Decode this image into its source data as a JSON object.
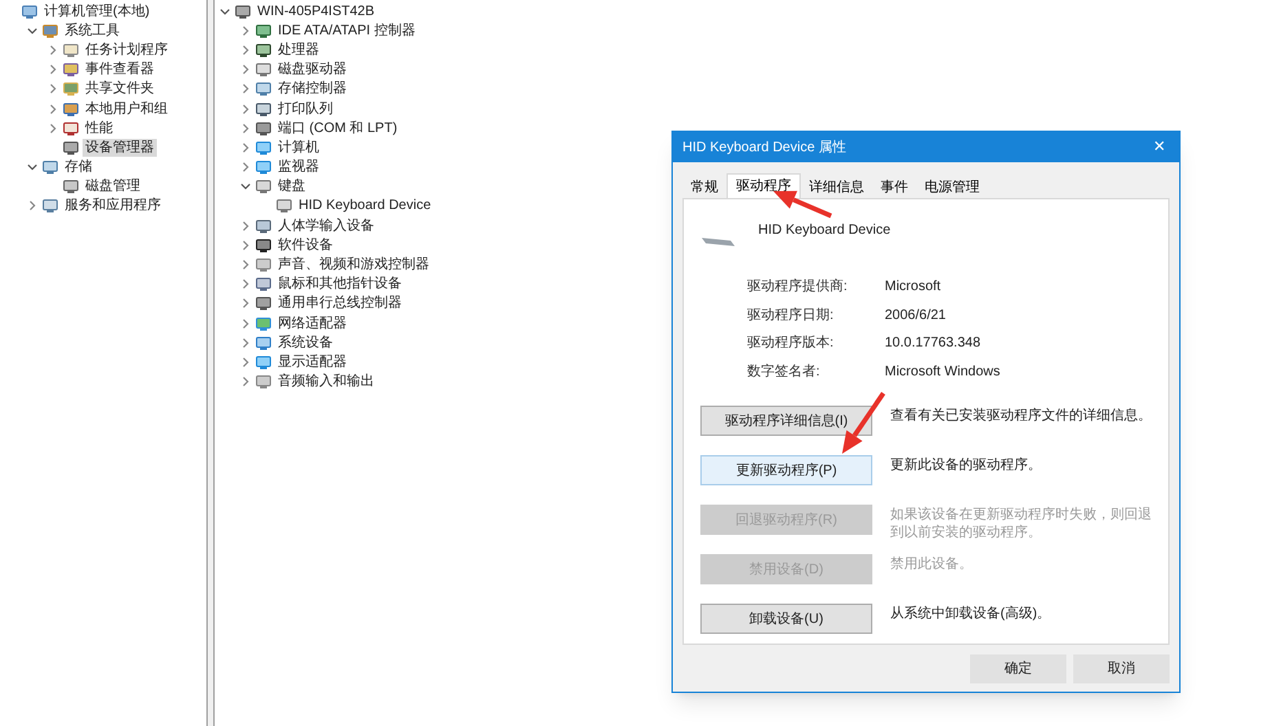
{
  "left_tree": [
    {
      "label": "计算机管理(本地)",
      "kind": "computer",
      "children": [
        {
          "label": "系统工具",
          "kind": "tools",
          "expanded": true,
          "selected": false,
          "children": [
            {
              "label": "任务计划程序",
              "kind": "clock",
              "expanded": false,
              "selected": false
            },
            {
              "label": "事件查看器",
              "kind": "events",
              "expanded": false,
              "selected": false
            },
            {
              "label": "共享文件夹",
              "kind": "folder",
              "expanded": false,
              "selected": false
            },
            {
              "label": "本地用户和组",
              "kind": "users",
              "expanded": false,
              "selected": false
            },
            {
              "label": "性能",
              "kind": "performance",
              "expanded": false,
              "selected": false
            },
            {
              "label": "设备管理器",
              "kind": "device",
              "selected": true
            }
          ]
        },
        {
          "label": "存储",
          "kind": "storage",
          "expanded": true,
          "selected": false,
          "children": [
            {
              "label": "磁盘管理",
              "kind": "disk",
              "selected": false
            }
          ]
        },
        {
          "label": "服务和应用程序",
          "kind": "services",
          "expanded": false,
          "selected": false
        }
      ]
    }
  ],
  "device_tree": [
    {
      "label": "WIN-405P4IST42B",
      "kind": "device",
      "expanded": true,
      "children": [
        {
          "label": "IDE ATA/ATAPI 控制器",
          "kind": "chip",
          "expanded": false
        },
        {
          "label": "处理器",
          "kind": "cpu",
          "expanded": false
        },
        {
          "label": "磁盘驱动器",
          "kind": "drive",
          "expanded": false
        },
        {
          "label": "存储控制器",
          "kind": "storage",
          "expanded": false
        },
        {
          "label": "打印队列",
          "kind": "printer",
          "expanded": false
        },
        {
          "label": "端口 (COM 和 LPT)",
          "kind": "port",
          "expanded": false
        },
        {
          "label": "计算机",
          "kind": "monitor",
          "expanded": false
        },
        {
          "label": "监视器",
          "kind": "monitor",
          "expanded": false
        },
        {
          "label": "键盘",
          "kind": "keyboard",
          "expanded": true,
          "children": [
            {
              "label": "HID Keyboard Device",
              "kind": "keyboard"
            }
          ]
        },
        {
          "label": "人体学输入设备",
          "kind": "hid",
          "expanded": false
        },
        {
          "label": "软件设备",
          "kind": "software",
          "expanded": false
        },
        {
          "label": "声音、视频和游戏控制器",
          "kind": "sound",
          "expanded": false
        },
        {
          "label": "鼠标和其他指针设备",
          "kind": "mouse",
          "expanded": false
        },
        {
          "label": "通用串行总线控制器",
          "kind": "usb",
          "expanded": false
        },
        {
          "label": "网络适配器",
          "kind": "network",
          "expanded": false
        },
        {
          "label": "系统设备",
          "kind": "system",
          "expanded": false
        },
        {
          "label": "显示适配器",
          "kind": "monitor",
          "expanded": false
        },
        {
          "label": "音频输入和输出",
          "kind": "sound",
          "expanded": false
        }
      ]
    }
  ],
  "dialog": {
    "title": "HID Keyboard Device 属性",
    "close": "✕",
    "tabs": [
      {
        "label": "常规",
        "selected": false
      },
      {
        "label": "驱动程序",
        "selected": true
      },
      {
        "label": "详细信息",
        "selected": false
      },
      {
        "label": "事件",
        "selected": false
      },
      {
        "label": "电源管理",
        "selected": false
      }
    ],
    "device_name": "HID Keyboard Device",
    "properties": [
      {
        "label": "驱动程序提供商:",
        "value": "Microsoft"
      },
      {
        "label": "驱动程序日期:",
        "value": "2006/6/21"
      },
      {
        "label": "驱动程序版本:",
        "value": "10.0.17763.348"
      },
      {
        "label": "数字签名者:",
        "value": "Microsoft Windows"
      }
    ],
    "actions": [
      {
        "button": "驱动程序详细信息(I)",
        "description": "查看有关已安装驱动程序文件的详细信息。",
        "disabled": false,
        "hovered": false
      },
      {
        "button": "更新驱动程序(P)",
        "description": "更新此设备的驱动程序。",
        "disabled": false,
        "hovered": true
      },
      {
        "button": "回退驱动程序(R)",
        "description": "如果该设备在更新驱动程序时失败，则回退到以前安装的驱动程序。",
        "disabled": true,
        "hovered": false
      },
      {
        "button": "禁用设备(D)",
        "description": "禁用此设备。",
        "disabled": true,
        "hovered": false
      },
      {
        "button": "卸载设备(U)",
        "description": "从系统中卸载设备(高级)。",
        "disabled": false,
        "hovered": false
      }
    ],
    "footer_buttons": [
      "确定",
      "取消"
    ]
  }
}
